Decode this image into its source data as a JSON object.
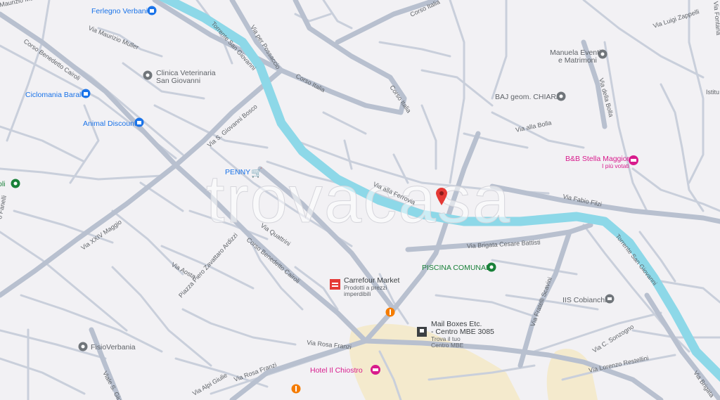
{
  "map": {
    "watermark": "trovacasa",
    "colors": {
      "background": "#f2f1f4",
      "road": "#c9cfdb",
      "road_major": "#b8c0cf",
      "river": "#8dd8e8",
      "urban_area": "#f4eacd",
      "marker": "#e53935",
      "poi_blue": "#1a73e8",
      "poi_grey": "#5f6368",
      "poi_pink": "#d81b8c",
      "poi_green": "#188038",
      "poi_orange": "#f57c00"
    },
    "streets": {
      "via_maurizio_muller_top": "Maurizio Muller",
      "via_maurizio_muller": "Via Maurizio Muller",
      "corso_benedetto_cairoli_top": "Corso Benedetto Cairoli",
      "via_per_possaccio": "Via per Possaccio",
      "corso_italia_top": "Corso Italia",
      "corso_italia_mid": "Corso Italia",
      "corso_italia_curve": "Corso Italia",
      "torrente_top": "Torrente San Giovanni",
      "torrente_right": "Torrente San Giovanni",
      "via_luigi_zappelli": "Via Luigi Zappelli",
      "via_della_bolla": "Via della Bolla",
      "via_alla_bolla": "Via alla Bolla",
      "via_s_giovanni_bosco": "Via S. Giovanni Bosco",
      "via_alla_ferrovia": "Via alla Ferrovia",
      "via_fabio_filzi": "Via Fabio Filzi",
      "via_brigata_cesare_battisti": "Via Brigata Cesare Battisti",
      "via_xxiv_maggio": "Via XXIV Maggio",
      "via_quattrini": "Via Quattrini",
      "corso_benedetto_cairoli": "Corso Benedetto Cairoli",
      "piazza_zavattaro": "Piazza Piero Zavattaro Ardizzi",
      "via_aosta": "Via Aosta",
      "via_rosa_franzi": "Via Rosa Franzi",
      "via_rosa_franzi_2": "Via Rosa Franzi",
      "via_alpi_giulie": "Via Alpi Giulie",
      "viale_s_giuseppe": "Viale S. Giu",
      "via_fratelli_scavini": "Via Fratelli Scavini",
      "via_c_sonzogno": "Via C. Sonzogno",
      "via_lorenzo_restellini": "Via Lorenzo Restellini",
      "via_brigata_right": "Via Brigata",
      "fanelli_fragment": "o Fanelli",
      "via_fontana": "Via Fontana",
      "istitu_fragment": "Istitu"
    },
    "pois": {
      "ferlegno": "Ferlegno Verbania",
      "clinica": "Clinica Veterinaria\nSan Giovanni",
      "ciclomania": "Ciclomania Barale",
      "animal_discount": "Animal Discount",
      "penny": "PENNY",
      "manuela": "Manuela Eventi\ne Matrimoni",
      "baj": "BAJ geom. CHIARA",
      "bnb": "B&B Stella Maggiore",
      "bnb_sub": "I più votati",
      "left_edge": "oli",
      "piscina": "PISCINA COMUNALE",
      "iis": "IIS Cobianchi",
      "carrefour": "Carrefour Market",
      "carrefour_sub": "Prodotti a prezzi\nimperdibili",
      "mailboxes": "Mail Boxes Etc.\n- Centro MBE 3085",
      "mailboxes_sub": "Trova il tuo\nCentro MBE",
      "fisio": "FisioVerbania",
      "hotel": "Hotel Il Chiostro"
    }
  }
}
